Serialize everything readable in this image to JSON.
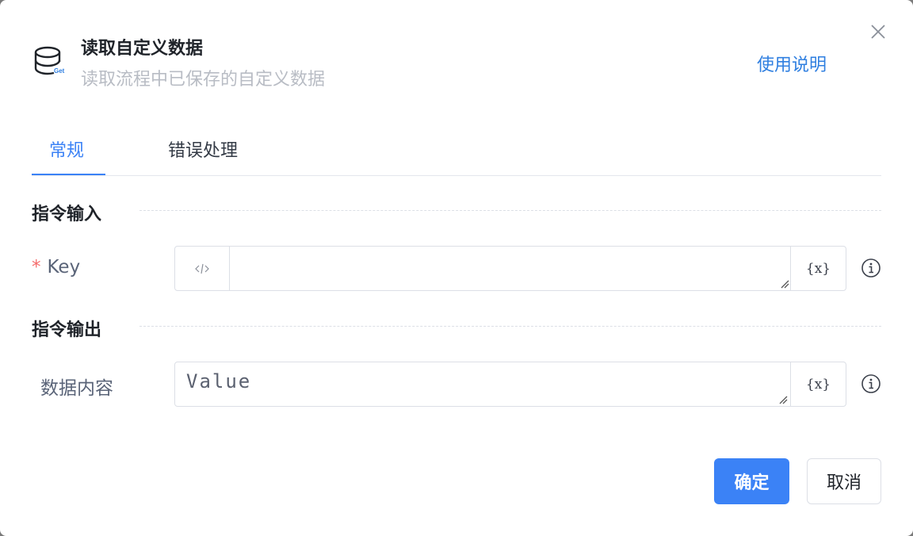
{
  "dialog": {
    "title": "读取自定义数据",
    "subtitle": "读取流程中已保存的自定义数据",
    "help_link": "使用说明",
    "icon_badge": "Get"
  },
  "tabs": [
    {
      "label": "常规",
      "active": true
    },
    {
      "label": "错误处理",
      "active": false
    }
  ],
  "sections": {
    "input": {
      "title": "指令输入"
    },
    "output": {
      "title": "指令输出"
    }
  },
  "fields": {
    "key": {
      "label": "Key",
      "required_mark": "*",
      "value": "",
      "prefix_icon": "code-icon",
      "var_label": "{x}"
    },
    "data": {
      "label": "数据内容",
      "value": "Value",
      "var_label": "{x}"
    }
  },
  "buttons": {
    "confirm": "确定",
    "cancel": "取消"
  },
  "colors": {
    "accent": "#3b82f6",
    "required": "#f56c6c"
  }
}
